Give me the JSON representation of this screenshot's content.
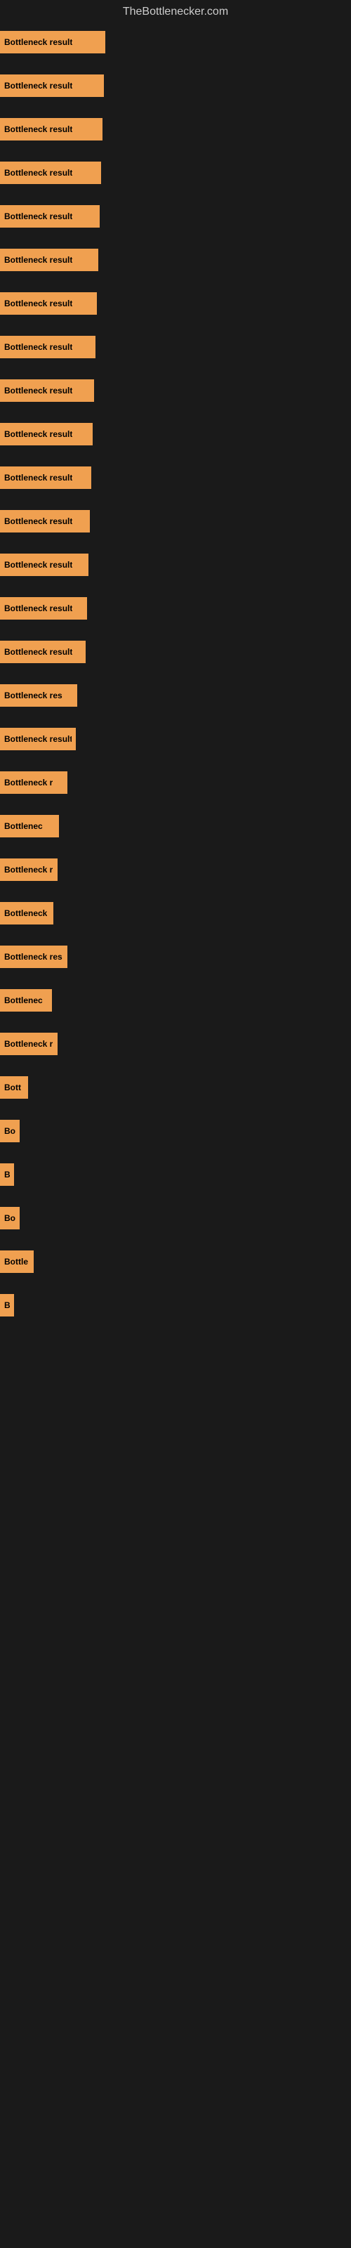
{
  "header": {
    "title": "TheBottlenecker.com"
  },
  "bars": [
    {
      "label": "Bottleneck result",
      "width": 150,
      "visible_label": "Bottleneck result"
    },
    {
      "label": "Bottleneck result",
      "width": 148,
      "visible_label": "Bottleneck result"
    },
    {
      "label": "Bottleneck result",
      "width": 146,
      "visible_label": "Bottleneck result"
    },
    {
      "label": "Bottleneck result",
      "width": 144,
      "visible_label": "Bottleneck result"
    },
    {
      "label": "Bottleneck result",
      "width": 142,
      "visible_label": "Bottleneck result"
    },
    {
      "label": "Bottleneck result",
      "width": 140,
      "visible_label": "Bottleneck result"
    },
    {
      "label": "Bottleneck result",
      "width": 138,
      "visible_label": "Bottleneck result"
    },
    {
      "label": "Bottleneck result",
      "width": 136,
      "visible_label": "Bottleneck result"
    },
    {
      "label": "Bottleneck result",
      "width": 134,
      "visible_label": "Bottleneck result"
    },
    {
      "label": "Bottleneck result",
      "width": 132,
      "visible_label": "Bottleneck result"
    },
    {
      "label": "Bottleneck result",
      "width": 130,
      "visible_label": "Bottleneck result"
    },
    {
      "label": "Bottleneck result",
      "width": 128,
      "visible_label": "Bottleneck result"
    },
    {
      "label": "Bottleneck result",
      "width": 126,
      "visible_label": "Bottleneck result"
    },
    {
      "label": "Bottleneck result",
      "width": 124,
      "visible_label": "Bottleneck result"
    },
    {
      "label": "Bottleneck result",
      "width": 122,
      "visible_label": "Bottleneck result"
    },
    {
      "label": "Bottleneck res",
      "width": 110,
      "visible_label": "Bottleneck res"
    },
    {
      "label": "Bottleneck result",
      "width": 108,
      "visible_label": "Bottleneck result"
    },
    {
      "label": "Bottleneck r",
      "width": 96,
      "visible_label": "Bottleneck r"
    },
    {
      "label": "Bottlenec",
      "width": 84,
      "visible_label": "Bottlenec"
    },
    {
      "label": "Bottleneck r",
      "width": 82,
      "visible_label": "Bottleneck r"
    },
    {
      "label": "Bottleneck",
      "width": 76,
      "visible_label": "Bottleneck"
    },
    {
      "label": "Bottleneck res",
      "width": 96,
      "visible_label": "Bottleneck res"
    },
    {
      "label": "Bottlenec",
      "width": 74,
      "visible_label": "Bottlenec"
    },
    {
      "label": "Bottleneck r",
      "width": 82,
      "visible_label": "Bottleneck r"
    },
    {
      "label": "Bott",
      "width": 40,
      "visible_label": "Bott"
    },
    {
      "label": "Bo",
      "width": 28,
      "visible_label": "Bo"
    },
    {
      "label": "B",
      "width": 14,
      "visible_label": "B"
    },
    {
      "label": "Bo",
      "width": 28,
      "visible_label": "Bo"
    },
    {
      "label": "Bottle",
      "width": 48,
      "visible_label": "Bottle"
    },
    {
      "label": "B",
      "width": 12,
      "visible_label": "B"
    }
  ]
}
